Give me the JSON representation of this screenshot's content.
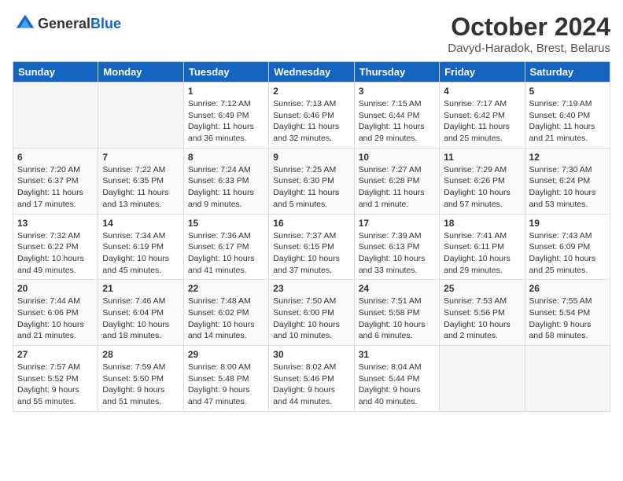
{
  "header": {
    "logo_general": "General",
    "logo_blue": "Blue",
    "title": "October 2024",
    "location": "Davyd-Haradok, Brest, Belarus"
  },
  "days_of_week": [
    "Sunday",
    "Monday",
    "Tuesday",
    "Wednesday",
    "Thursday",
    "Friday",
    "Saturday"
  ],
  "weeks": [
    [
      {
        "day": "",
        "info": ""
      },
      {
        "day": "",
        "info": ""
      },
      {
        "day": "1",
        "info": "Sunrise: 7:12 AM\nSunset: 6:49 PM\nDaylight: 11 hours and 36 minutes."
      },
      {
        "day": "2",
        "info": "Sunrise: 7:13 AM\nSunset: 6:46 PM\nDaylight: 11 hours and 32 minutes."
      },
      {
        "day": "3",
        "info": "Sunrise: 7:15 AM\nSunset: 6:44 PM\nDaylight: 11 hours and 29 minutes."
      },
      {
        "day": "4",
        "info": "Sunrise: 7:17 AM\nSunset: 6:42 PM\nDaylight: 11 hours and 25 minutes."
      },
      {
        "day": "5",
        "info": "Sunrise: 7:19 AM\nSunset: 6:40 PM\nDaylight: 11 hours and 21 minutes."
      }
    ],
    [
      {
        "day": "6",
        "info": "Sunrise: 7:20 AM\nSunset: 6:37 PM\nDaylight: 11 hours and 17 minutes."
      },
      {
        "day": "7",
        "info": "Sunrise: 7:22 AM\nSunset: 6:35 PM\nDaylight: 11 hours and 13 minutes."
      },
      {
        "day": "8",
        "info": "Sunrise: 7:24 AM\nSunset: 6:33 PM\nDaylight: 11 hours and 9 minutes."
      },
      {
        "day": "9",
        "info": "Sunrise: 7:25 AM\nSunset: 6:30 PM\nDaylight: 11 hours and 5 minutes."
      },
      {
        "day": "10",
        "info": "Sunrise: 7:27 AM\nSunset: 6:28 PM\nDaylight: 11 hours and 1 minute."
      },
      {
        "day": "11",
        "info": "Sunrise: 7:29 AM\nSunset: 6:26 PM\nDaylight: 10 hours and 57 minutes."
      },
      {
        "day": "12",
        "info": "Sunrise: 7:30 AM\nSunset: 6:24 PM\nDaylight: 10 hours and 53 minutes."
      }
    ],
    [
      {
        "day": "13",
        "info": "Sunrise: 7:32 AM\nSunset: 6:22 PM\nDaylight: 10 hours and 49 minutes."
      },
      {
        "day": "14",
        "info": "Sunrise: 7:34 AM\nSunset: 6:19 PM\nDaylight: 10 hours and 45 minutes."
      },
      {
        "day": "15",
        "info": "Sunrise: 7:36 AM\nSunset: 6:17 PM\nDaylight: 10 hours and 41 minutes."
      },
      {
        "day": "16",
        "info": "Sunrise: 7:37 AM\nSunset: 6:15 PM\nDaylight: 10 hours and 37 minutes."
      },
      {
        "day": "17",
        "info": "Sunrise: 7:39 AM\nSunset: 6:13 PM\nDaylight: 10 hours and 33 minutes."
      },
      {
        "day": "18",
        "info": "Sunrise: 7:41 AM\nSunset: 6:11 PM\nDaylight: 10 hours and 29 minutes."
      },
      {
        "day": "19",
        "info": "Sunrise: 7:43 AM\nSunset: 6:09 PM\nDaylight: 10 hours and 25 minutes."
      }
    ],
    [
      {
        "day": "20",
        "info": "Sunrise: 7:44 AM\nSunset: 6:06 PM\nDaylight: 10 hours and 21 minutes."
      },
      {
        "day": "21",
        "info": "Sunrise: 7:46 AM\nSunset: 6:04 PM\nDaylight: 10 hours and 18 minutes."
      },
      {
        "day": "22",
        "info": "Sunrise: 7:48 AM\nSunset: 6:02 PM\nDaylight: 10 hours and 14 minutes."
      },
      {
        "day": "23",
        "info": "Sunrise: 7:50 AM\nSunset: 6:00 PM\nDaylight: 10 hours and 10 minutes."
      },
      {
        "day": "24",
        "info": "Sunrise: 7:51 AM\nSunset: 5:58 PM\nDaylight: 10 hours and 6 minutes."
      },
      {
        "day": "25",
        "info": "Sunrise: 7:53 AM\nSunset: 5:56 PM\nDaylight: 10 hours and 2 minutes."
      },
      {
        "day": "26",
        "info": "Sunrise: 7:55 AM\nSunset: 5:54 PM\nDaylight: 9 hours and 58 minutes."
      }
    ],
    [
      {
        "day": "27",
        "info": "Sunrise: 7:57 AM\nSunset: 5:52 PM\nDaylight: 9 hours and 55 minutes."
      },
      {
        "day": "28",
        "info": "Sunrise: 7:59 AM\nSunset: 5:50 PM\nDaylight: 9 hours and 51 minutes."
      },
      {
        "day": "29",
        "info": "Sunrise: 8:00 AM\nSunset: 5:48 PM\nDaylight: 9 hours and 47 minutes."
      },
      {
        "day": "30",
        "info": "Sunrise: 8:02 AM\nSunset: 5:46 PM\nDaylight: 9 hours and 44 minutes."
      },
      {
        "day": "31",
        "info": "Sunrise: 8:04 AM\nSunset: 5:44 PM\nDaylight: 9 hours and 40 minutes."
      },
      {
        "day": "",
        "info": ""
      },
      {
        "day": "",
        "info": ""
      }
    ]
  ]
}
